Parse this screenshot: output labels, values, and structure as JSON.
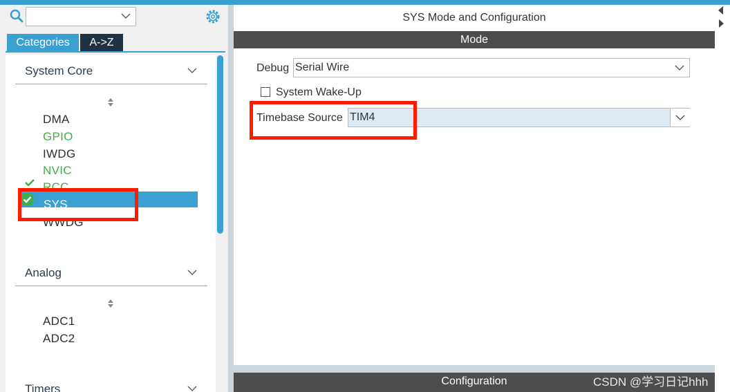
{
  "left": {
    "search": {
      "value": "",
      "icon": "search-icon"
    },
    "tabs": [
      {
        "label": "Categories",
        "active": true
      },
      {
        "label": "A->Z",
        "active": false
      }
    ],
    "groups": [
      {
        "label": "System Core",
        "items": [
          {
            "label": "DMA",
            "state": "normal"
          },
          {
            "label": "GPIO",
            "state": "configured"
          },
          {
            "label": "IWDG",
            "state": "normal"
          },
          {
            "label": "NVIC",
            "state": "configured"
          },
          {
            "label": "RCC",
            "state": "configured-checked"
          },
          {
            "label": "SYS",
            "state": "selected-checked"
          },
          {
            "label": "WWDG",
            "state": "normal"
          }
        ]
      },
      {
        "label": "Analog",
        "items": [
          {
            "label": "ADC1",
            "state": "normal"
          },
          {
            "label": "ADC2",
            "state": "normal"
          }
        ]
      },
      {
        "label": "Timers",
        "items": []
      }
    ]
  },
  "right": {
    "title": "SYS Mode and Configuration",
    "mode_label": "Mode",
    "debug": {
      "label": "Debug",
      "value": "Serial Wire"
    },
    "wakeup": {
      "label": "System Wake-Up",
      "checked": false
    },
    "timebase": {
      "label": "Timebase Source",
      "value": "TIM4"
    },
    "configuration_label": "Configuration"
  },
  "watermark": "CSDN @学习日记hhh",
  "colors": {
    "accent": "#3aa0d2",
    "configured": "#3fae49",
    "highlight": "#ff1a00",
    "bar": "#4d4d4d"
  }
}
